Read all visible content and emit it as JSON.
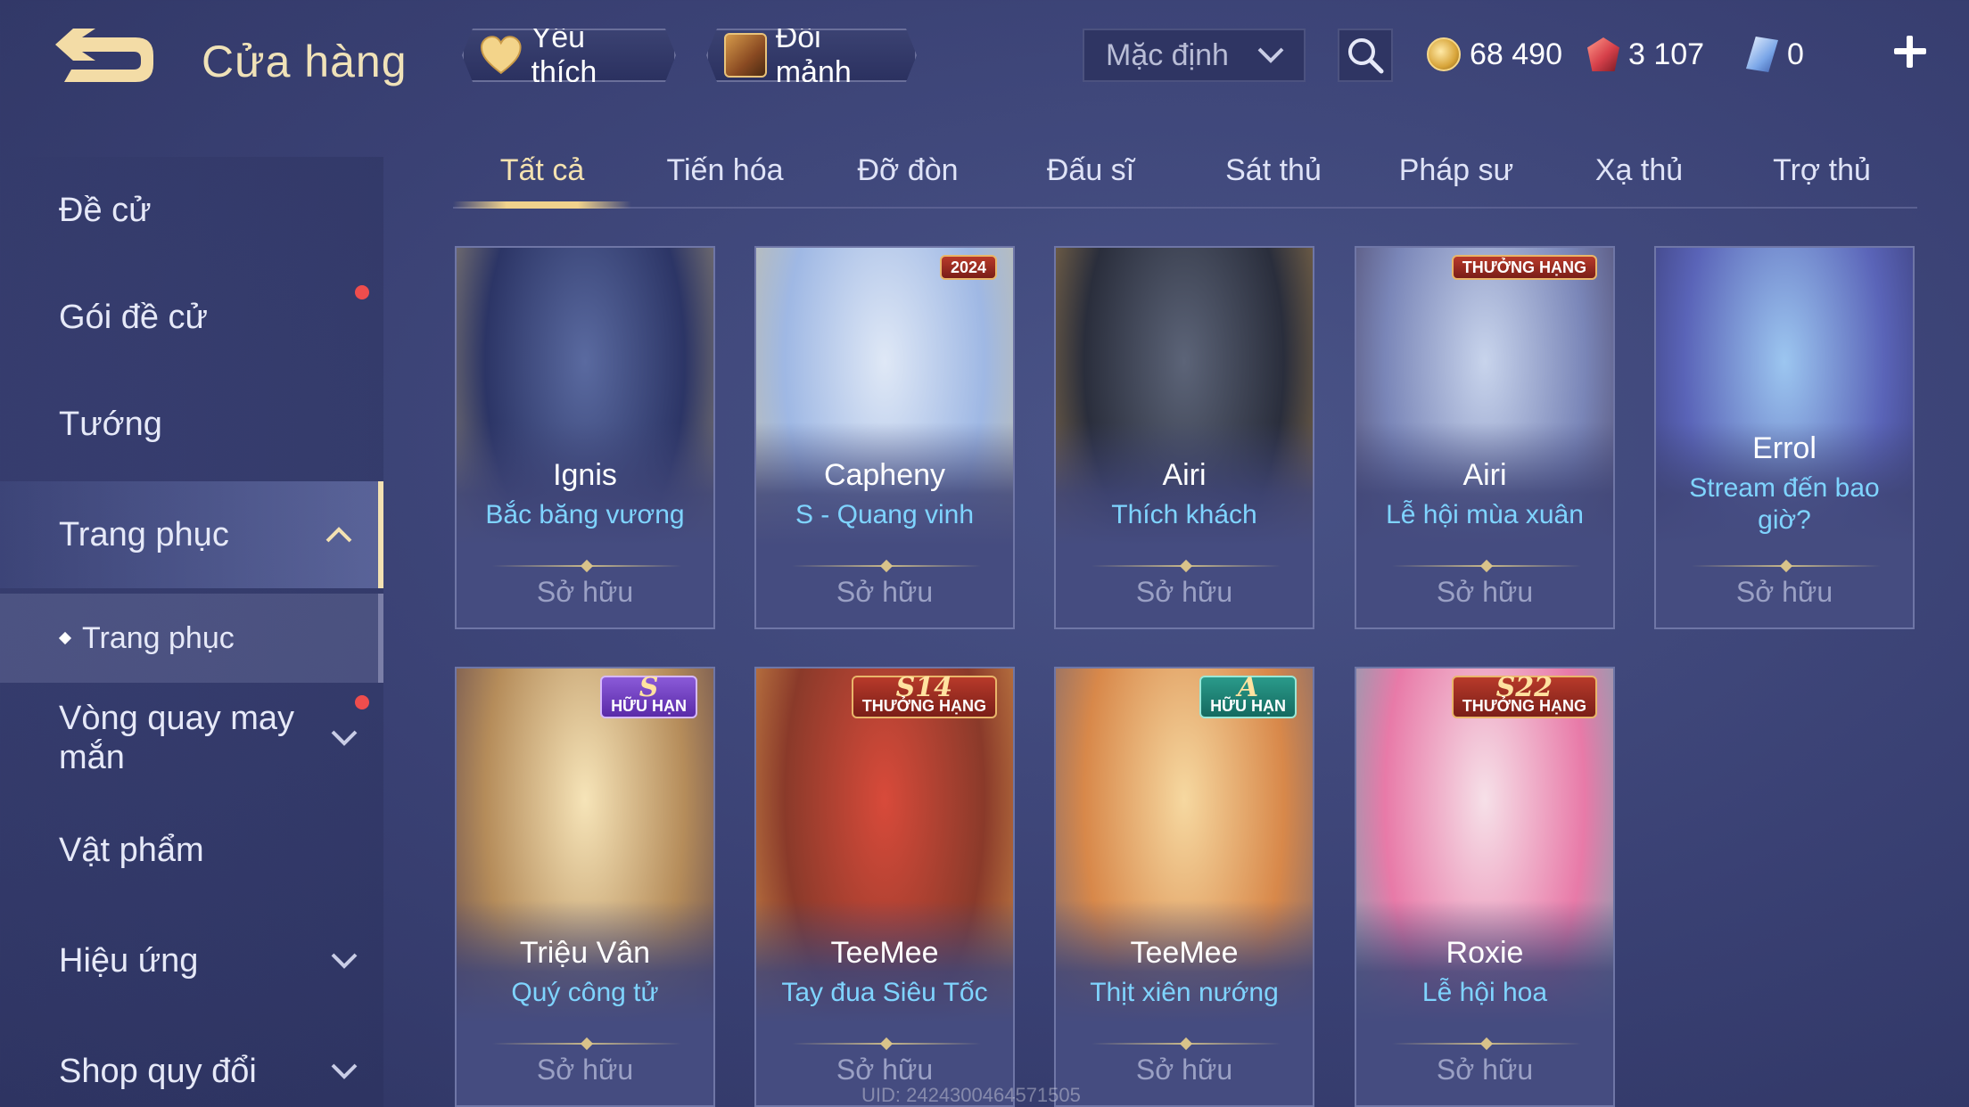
{
  "header": {
    "title": "Cửa hàng",
    "favorite_label": "Yêu thích",
    "shard_exchange_label": "Đổi mảnh",
    "sort_selected": "Mặc định"
  },
  "currencies": {
    "gold": "68 490",
    "voucher": "3 107",
    "diamond": "0"
  },
  "sidebar": {
    "items": [
      {
        "label": "Đề cử"
      },
      {
        "label": "Gói đề cử"
      },
      {
        "label": "Tướng"
      },
      {
        "label": "Trang phục"
      },
      {
        "label": "Trang phục"
      },
      {
        "label": "Vòng quay may\nmắn"
      },
      {
        "label": "Vật phẩm"
      },
      {
        "label": "Hiệu ứng"
      },
      {
        "label": "Shop quy đổi"
      }
    ]
  },
  "tabs": [
    {
      "label": "Tất cả",
      "active": true
    },
    {
      "label": "Tiến hóa"
    },
    {
      "label": "Đỡ đòn"
    },
    {
      "label": "Đấu sĩ"
    },
    {
      "label": "Sát thủ"
    },
    {
      "label": "Pháp sư"
    },
    {
      "label": "Xạ thủ"
    },
    {
      "label": "Trợ thủ"
    }
  ],
  "cards": [
    {
      "hero": "Ignis",
      "skin": "Bắc băng vương",
      "status": "Sở hữu",
      "art_colors": [
        "#5a6aa0",
        "#2c3566",
        "#c9b37a"
      ]
    },
    {
      "hero": "Capheny",
      "skin": "S - Quang vinh",
      "status": "Sở hữu",
      "badge": "2024",
      "art_colors": [
        "#dfe8f6",
        "#9fb8e4",
        "#d6c28a"
      ]
    },
    {
      "hero": "Airi",
      "skin": "Thích khách",
      "status": "Sở hữu",
      "art_colors": [
        "#5c6478",
        "#2a2e3c",
        "#c89a52"
      ]
    },
    {
      "hero": "Airi",
      "skin": "Lễ hội mùa xuân",
      "status": "Sở hữu",
      "badge": "THƯỞNG HẠNG",
      "art_colors": [
        "#c8d4ec",
        "#7a86b8",
        "#3a2c48"
      ]
    },
    {
      "hero": "Errol",
      "skin": "Stream đến bao giờ?",
      "status": "Sở hữu",
      "art_colors": [
        "#9cc6f0",
        "#5a64b8",
        "#2a2a58"
      ]
    },
    {
      "hero": "Triệu Vân",
      "skin": "Quý công tử",
      "status": "Sở hữu",
      "badge_top": "S",
      "badge": "HỮU HẠN",
      "art_colors": [
        "#f6e4b8",
        "#b58c5a",
        "#3c2a4a"
      ]
    },
    {
      "hero": "TeeMee",
      "skin": "Tay đua Siêu Tốc",
      "status": "Sở hữu",
      "badge_top": "S14",
      "badge": "THƯỞNG HẠNG",
      "art_colors": [
        "#d84a3a",
        "#8a3a2a",
        "#f0b85a"
      ]
    },
    {
      "hero": "TeeMee",
      "skin": "Thịt xiên nướng",
      "status": "Sở hữu",
      "badge_top": "A",
      "badge": "HỮU HẠN",
      "art_colors": [
        "#f6d8a0",
        "#d8884a",
        "#4a5a88"
      ]
    },
    {
      "hero": "Roxie",
      "skin": "Lễ hội hoa",
      "status": "Sở hữu",
      "badge_top": "S22",
      "badge": "THƯỞNG HẠNG",
      "art_colors": [
        "#f6e0e8",
        "#e87aa8",
        "#3ac0b8"
      ]
    }
  ],
  "footer": {
    "uid": "UID: 2424300464571505"
  }
}
